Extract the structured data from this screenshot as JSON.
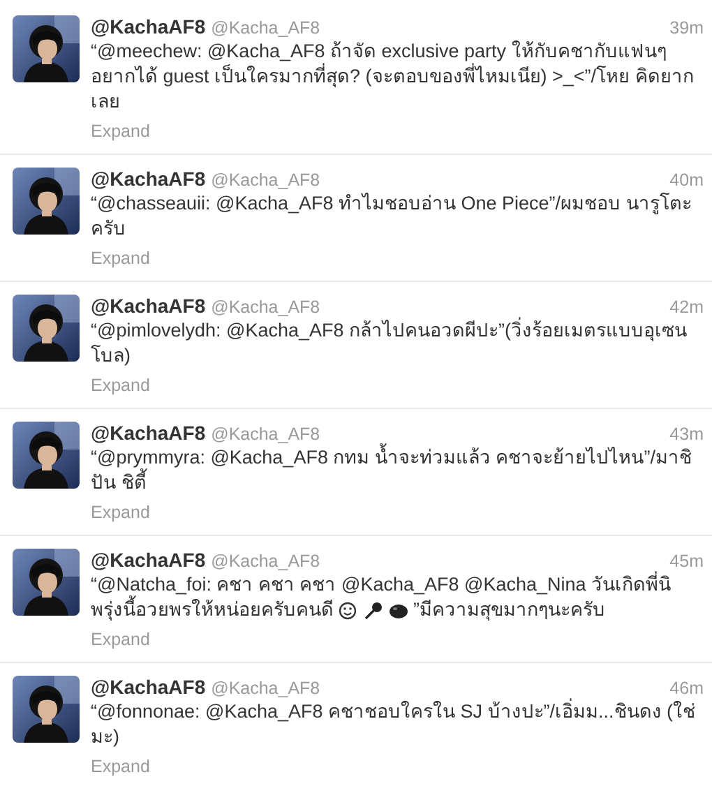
{
  "tweets": [
    {
      "name": "@KachaAF8",
      "handle": "@Kacha_AF8",
      "time": "39m",
      "text": "“@meechew: @Kacha_AF8 ถ้าจัด exclusive party ให้กับคชากับแฟนๆ อยากได้ guest เป็นใครมากที่สุด? (จะตอบของพี่ไหมเนีย) >_<”/โหย คิดยาก เลย",
      "expand": "Expand"
    },
    {
      "name": "@KachaAF8",
      "handle": "@Kacha_AF8",
      "time": "40m",
      "text": "“@chasseauii: @Kacha_AF8 ทำไมชอบอ่าน One Piece”/ผมชอบ นารูโตะ ครับ",
      "expand": "Expand"
    },
    {
      "name": "@KachaAF8",
      "handle": "@Kacha_AF8",
      "time": "42m",
      "text": "“@pimlovelydh: @Kacha_AF8 กล้าไปคนอวดผีปะ”(วิ่งร้อยเมตรแบบอุเซน โบล)",
      "expand": "Expand"
    },
    {
      "name": "@KachaAF8",
      "handle": "@Kacha_AF8",
      "time": "43m",
      "text": "“@prymmyra: @Kacha_AF8 กทม น้ำจะท่วมแล้ว คชาจะย้ายไปไหน”/มาชิ ปัน ชิตี้",
      "expand": "Expand"
    },
    {
      "name": "@KachaAF8",
      "handle": "@Kacha_AF8",
      "time": "45m",
      "text": "“@Natcha_foi: คชา คชา คชา @Kacha_AF8 @Kacha_Nina วันเกิดพี่นิ",
      "text_before_icons": "พรุ่งนี้อวยพรให้หน่อยครับคนดี",
      "text_after": "”มีความสุขมากๆนะครับ",
      "expand": "Expand"
    },
    {
      "name": "@KachaAF8",
      "handle": "@Kacha_AF8",
      "time": "46m",
      "text": "“@fonnonae: @Kacha_AF8 คชาชอบใครใน SJ บ้างปะ”/เอิ่มม...ชินดง (ใช่ มะ)",
      "expand": "Expand"
    }
  ]
}
